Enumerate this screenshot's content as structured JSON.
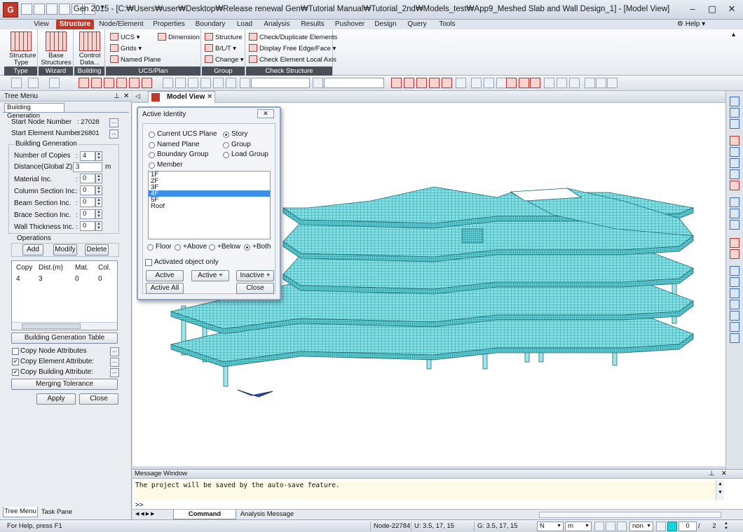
{
  "window": {
    "title": "Gen 2015 - [C:₩Users₩user₩Desktop₩Release renewal Gen₩Tutorial Manual₩Tutorial_2nd₩Models_test₩App9_Meshed Slab and Wall Design_1] - [Model View]",
    "app_icon_text": "G"
  },
  "menu": {
    "tabs": [
      "View",
      "Structure",
      "Node/Element",
      "Properties",
      "Boundary",
      "Load",
      "Analysis",
      "Results",
      "Pushover",
      "Design",
      "Query",
      "Tools"
    ],
    "active": "Structure",
    "help": "Help"
  },
  "ribbon": {
    "type_group": {
      "label": "Type",
      "button": "Structure Type"
    },
    "wizard_group": {
      "label": "Wizard",
      "button": "Base Structures"
    },
    "building_group": {
      "label": "Building",
      "button": "Control Data..."
    },
    "ucs_group": {
      "label": "UCS/Plan",
      "ucs": "UCS",
      "grids": "Grids",
      "named_plane": "Named Plane",
      "dimension": "Dimension"
    },
    "group_group": {
      "label": "Group",
      "structure": "Structure",
      "blt": "B/L/T",
      "change": "Change"
    },
    "check_group": {
      "label": "Check Structure",
      "check_dup": "Check/Duplicate Elements",
      "display_free": "Display Free Edge/Face",
      "check_axis": "Check Element Local Axis"
    }
  },
  "left_panel": {
    "header": "Tree Menu",
    "tab": "Building Generation",
    "start_node_label": "Start Node Number",
    "start_node": "27028",
    "start_elem_label": "Start Element Number",
    "start_elem": "26801",
    "section_title": "Building Generation",
    "copies_label": "Number of Copies",
    "copies": "4",
    "distance_label": "Distance(Global Z):",
    "distance": "3",
    "distance_unit": "m",
    "material_label": "Material Inc.",
    "material": "0",
    "column_label": "Column Section Inc.",
    "column": "0",
    "beam_label": "Beam Section Inc.",
    "beam": "0",
    "brace_label": "Brace Section Inc.",
    "brace": "0",
    "wall_label": "Wall Thickness Inc.",
    "wall": "0",
    "operations_label": "Operations",
    "add": "Add",
    "modify": "Modify",
    "delete": "Delete",
    "table_headers": [
      "Copy",
      "Dist.(m)",
      "Mat.",
      "Col."
    ],
    "table_row": [
      "4",
      "3",
      "0",
      "0"
    ],
    "gen_table_btn": "Building Generation Table",
    "copy_node_attr": "Copy Node Attributes",
    "copy_elem_attr": "Copy Element Attribute:",
    "copy_bldg_attr": "Copy Building Attribute:",
    "copy_node_checked": false,
    "copy_elem_checked": true,
    "copy_bldg_checked": true,
    "merging_btn": "Merging Tolerance",
    "apply": "Apply",
    "close": "Close",
    "bottom_tabs": [
      "Tree Menu",
      "Task Pane"
    ]
  },
  "model_view": {
    "tab": "Model View"
  },
  "dialog": {
    "title": "Active Identity",
    "options": {
      "current_ucs": "Current UCS Plane",
      "named_plane": "Named Plane",
      "boundary_group": "Boundary Group",
      "member": "Member",
      "story": "Story",
      "group": "Group",
      "load_group": "Load Group"
    },
    "selected_option": "Story",
    "stories": [
      "1F",
      "2F",
      "3F",
      "4F",
      "5F",
      "Roof"
    ],
    "selected_story": "4F",
    "range": {
      "floor": "Floor",
      "above": "+Above",
      "below": "+Below",
      "both": "+Both"
    },
    "selected_range": "+Both",
    "activated_only": "Activated object only",
    "buttons": {
      "active": "Active",
      "active_plus": "Active +",
      "inactive_plus": "Inactive +",
      "active_all": "Active All",
      "close": "Close"
    }
  },
  "message": {
    "header": "Message Window",
    "text": "The project will be saved by the auto-save feature.",
    "prompt": ">>",
    "tabs": [
      "Command Message",
      "Analysis Message"
    ]
  },
  "status": {
    "help": "For Help, press F1",
    "node": "Node-22784",
    "u": "U: 3.5, 17, 15",
    "g": "G: 3.5, 17, 15",
    "unit_force": "N",
    "unit_length": "m",
    "snap": "non",
    "page_current": "0",
    "page_total": "2"
  }
}
